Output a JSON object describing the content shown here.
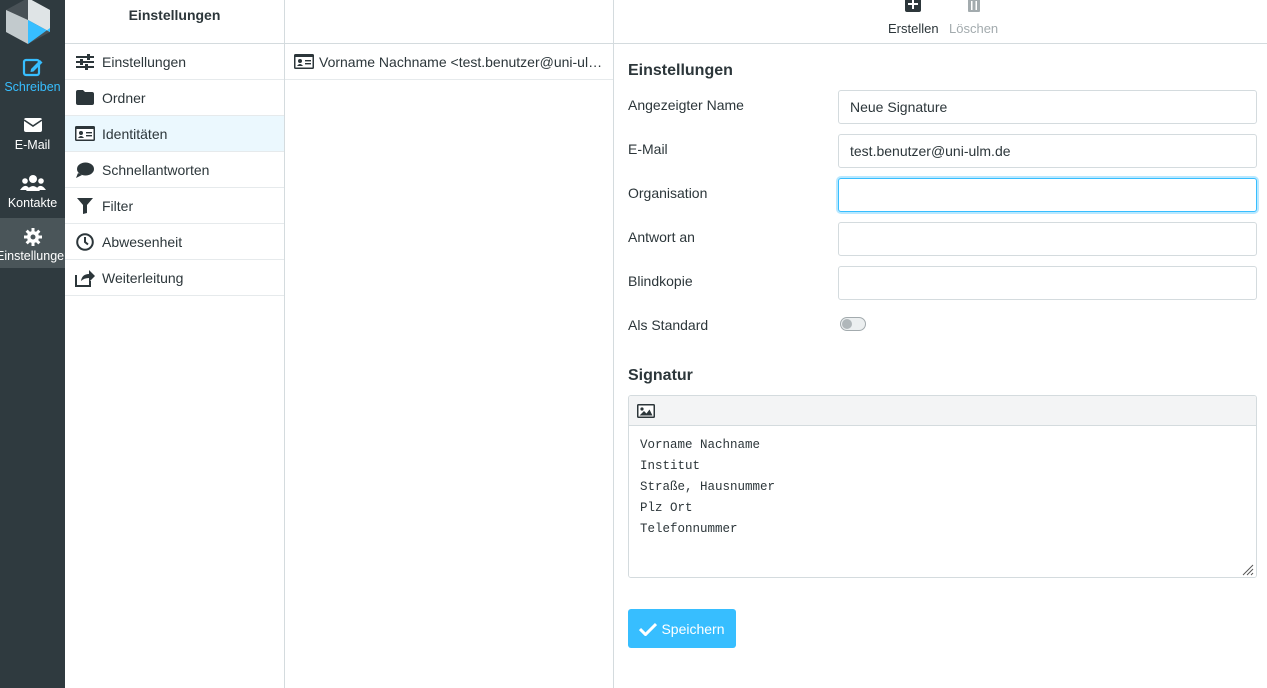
{
  "taskbar": {
    "compose_label": "Schreiben",
    "mail_label": "E-Mail",
    "contacts_label": "Kontakte",
    "settings_label": "Einstellungen"
  },
  "settings_menu": {
    "header": "Einstellungen",
    "items": [
      {
        "label": "Einstellungen",
        "icon": "sliders-icon"
      },
      {
        "label": "Ordner",
        "icon": "folder-icon"
      },
      {
        "label": "Identitäten",
        "icon": "id-card-icon"
      },
      {
        "label": "Schnellantworten",
        "icon": "comment-icon"
      },
      {
        "label": "Filter",
        "icon": "filter-icon"
      },
      {
        "label": "Abwesenheit",
        "icon": "clock-icon"
      },
      {
        "label": "Weiterleitung",
        "icon": "share-icon"
      }
    ],
    "selected_index": 2
  },
  "identities": {
    "items": [
      {
        "label": "Vorname Nachname <test.benutzer@uni-ulm.de>"
      }
    ]
  },
  "toolbar": {
    "create_label": "Erstellen",
    "delete_label": "Löschen"
  },
  "form": {
    "section_title": "Einstellungen",
    "display_name_label": "Angezeigter Name",
    "display_name_value": "Neue Signature",
    "email_label": "E-Mail",
    "email_value": "test.benutzer@uni-ulm.de",
    "organization_label": "Organisation",
    "organization_value": "",
    "reply_to_label": "Antwort an",
    "reply_to_value": "",
    "bcc_label": "Blindkopie",
    "bcc_value": "",
    "default_label": "Als Standard",
    "default_checked": false
  },
  "signature": {
    "section_title": "Signatur",
    "text": "Vorname Nachname\nInstitut\nStraße, Hausnummer\nPlz Ort\nTelefonnummer"
  },
  "save_label": "Speichern",
  "colors": {
    "accent": "#37beff",
    "taskbar_bg": "#2f3a3f",
    "selected_row_bg": "#ebf8fe"
  }
}
